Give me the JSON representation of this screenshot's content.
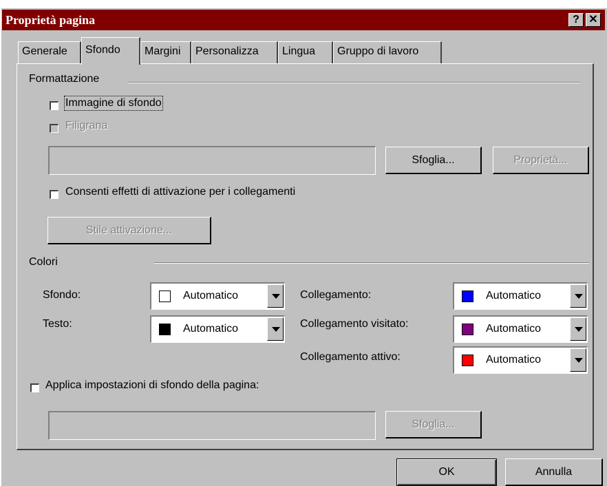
{
  "window": {
    "title": "Proprietà pagina",
    "help_button": "?",
    "close_button": "✕"
  },
  "tabs": [
    {
      "label": "Generale"
    },
    {
      "label": "Sfondo"
    },
    {
      "label": "Margini"
    },
    {
      "label": "Personalizza"
    },
    {
      "label": "Lingua"
    },
    {
      "label": "Gruppo di lavoro"
    }
  ],
  "formattazione": {
    "section_label": "Formattazione",
    "immagine_label": "Immagine di sfondo",
    "filigrana_label": "Filigrana",
    "image_path_value": "",
    "sfoglia_button": "Sfoglia...",
    "proprieta_button": "Proprietà...",
    "effetti_label": "Consenti effetti di attivazione per i collegamenti",
    "stile_button": "Stile attivazione..."
  },
  "colori": {
    "section_label": "Colori",
    "sfondo": {
      "label": "Sfondo:",
      "value": "Automatico",
      "color": "#ffffff"
    },
    "testo": {
      "label": "Testo:",
      "value": "Automatico",
      "color": "#000000"
    },
    "collegamento": {
      "label": "Collegamento:",
      "value": "Automatico",
      "color": "#0000ff"
    },
    "collegamento_visitato": {
      "label": "Collegamento visitato:",
      "value": "Automatico",
      "color": "#800080"
    },
    "collegamento_attivo": {
      "label": "Collegamento attivo:",
      "value": "Automatico",
      "color": "#ff0000"
    }
  },
  "applica": {
    "label": "Applica impostazioni di sfondo della pagina:",
    "path_value": "",
    "sfoglia_button": "Sfoglia..."
  },
  "footer": {
    "ok_button": "OK",
    "annulla_button": "Annulla"
  }
}
